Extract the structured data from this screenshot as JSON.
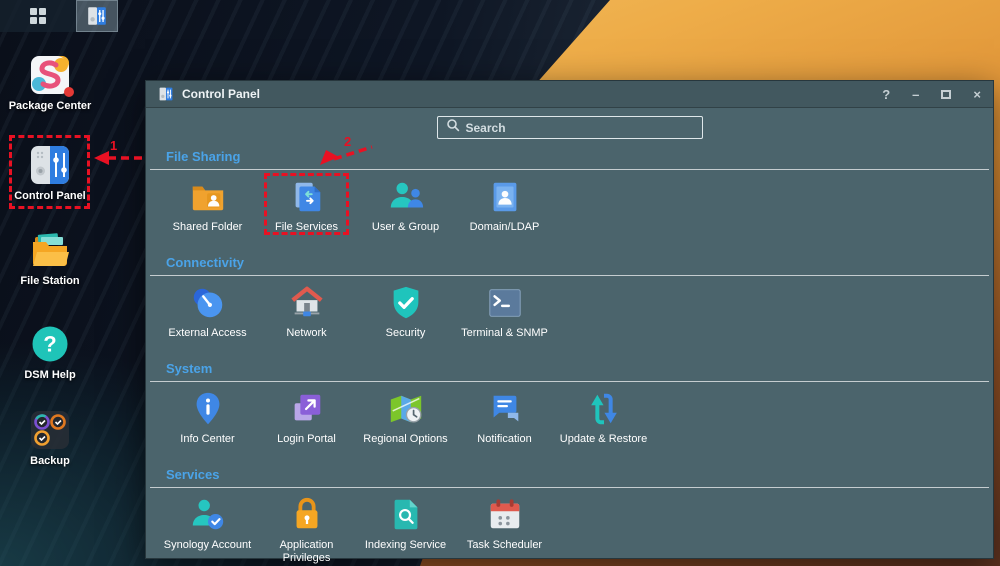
{
  "colors": {
    "annotation_red": "#e81123",
    "section_blue": "#4aa3e8",
    "window_bg": "#4b646c",
    "titlebar_bg": "#42585f"
  },
  "taskbar": {
    "buttons": [
      {
        "icon": "main-menu-grid-icon"
      },
      {
        "icon": "control-panel-icon",
        "active": true
      }
    ]
  },
  "desktop": {
    "icons": [
      {
        "label": "Package Center",
        "icon": "package-center-icon",
        "badge": true
      },
      {
        "label": "Control Panel",
        "icon": "control-panel-desktop-icon",
        "highlighted": true
      },
      {
        "label": "File Station",
        "icon": "file-station-icon"
      },
      {
        "label": "DSM Help",
        "icon": "dsm-help-icon"
      },
      {
        "label": "Backup",
        "icon": "backup-icon"
      }
    ],
    "annotations": [
      {
        "label": "1"
      },
      {
        "label": "2"
      }
    ]
  },
  "window": {
    "title": "Control Panel",
    "controls": {
      "help": "?",
      "minimize": "–",
      "close": "×"
    },
    "search": {
      "placeholder": "Search"
    },
    "sections": [
      {
        "title": "File Sharing",
        "items": [
          {
            "label": "Shared Folder",
            "icon": "shared-folder-icon"
          },
          {
            "label": "File Services",
            "icon": "file-services-icon",
            "highlighted": true
          },
          {
            "label": "User & Group",
            "icon": "user-group-icon"
          },
          {
            "label": "Domain/LDAP",
            "icon": "domain-ldap-icon"
          }
        ]
      },
      {
        "title": "Connectivity",
        "items": [
          {
            "label": "External Access",
            "icon": "external-access-icon"
          },
          {
            "label": "Network",
            "icon": "network-icon"
          },
          {
            "label": "Security",
            "icon": "security-icon"
          },
          {
            "label": "Terminal & SNMP",
            "icon": "terminal-snmp-icon"
          }
        ]
      },
      {
        "title": "System",
        "items": [
          {
            "label": "Info Center",
            "icon": "info-center-icon"
          },
          {
            "label": "Login Portal",
            "icon": "login-portal-icon"
          },
          {
            "label": "Regional Options",
            "icon": "regional-options-icon"
          },
          {
            "label": "Notification",
            "icon": "notification-icon"
          },
          {
            "label": "Update & Restore",
            "icon": "update-restore-icon"
          }
        ]
      },
      {
        "title": "Services",
        "items": [
          {
            "label": "Synology Account",
            "icon": "synology-account-icon"
          },
          {
            "label": "Application Privileges",
            "icon": "application-privileges-icon"
          },
          {
            "label": "Indexing Service",
            "icon": "indexing-service-icon"
          },
          {
            "label": "Task Scheduler",
            "icon": "task-scheduler-icon"
          }
        ]
      }
    ]
  }
}
